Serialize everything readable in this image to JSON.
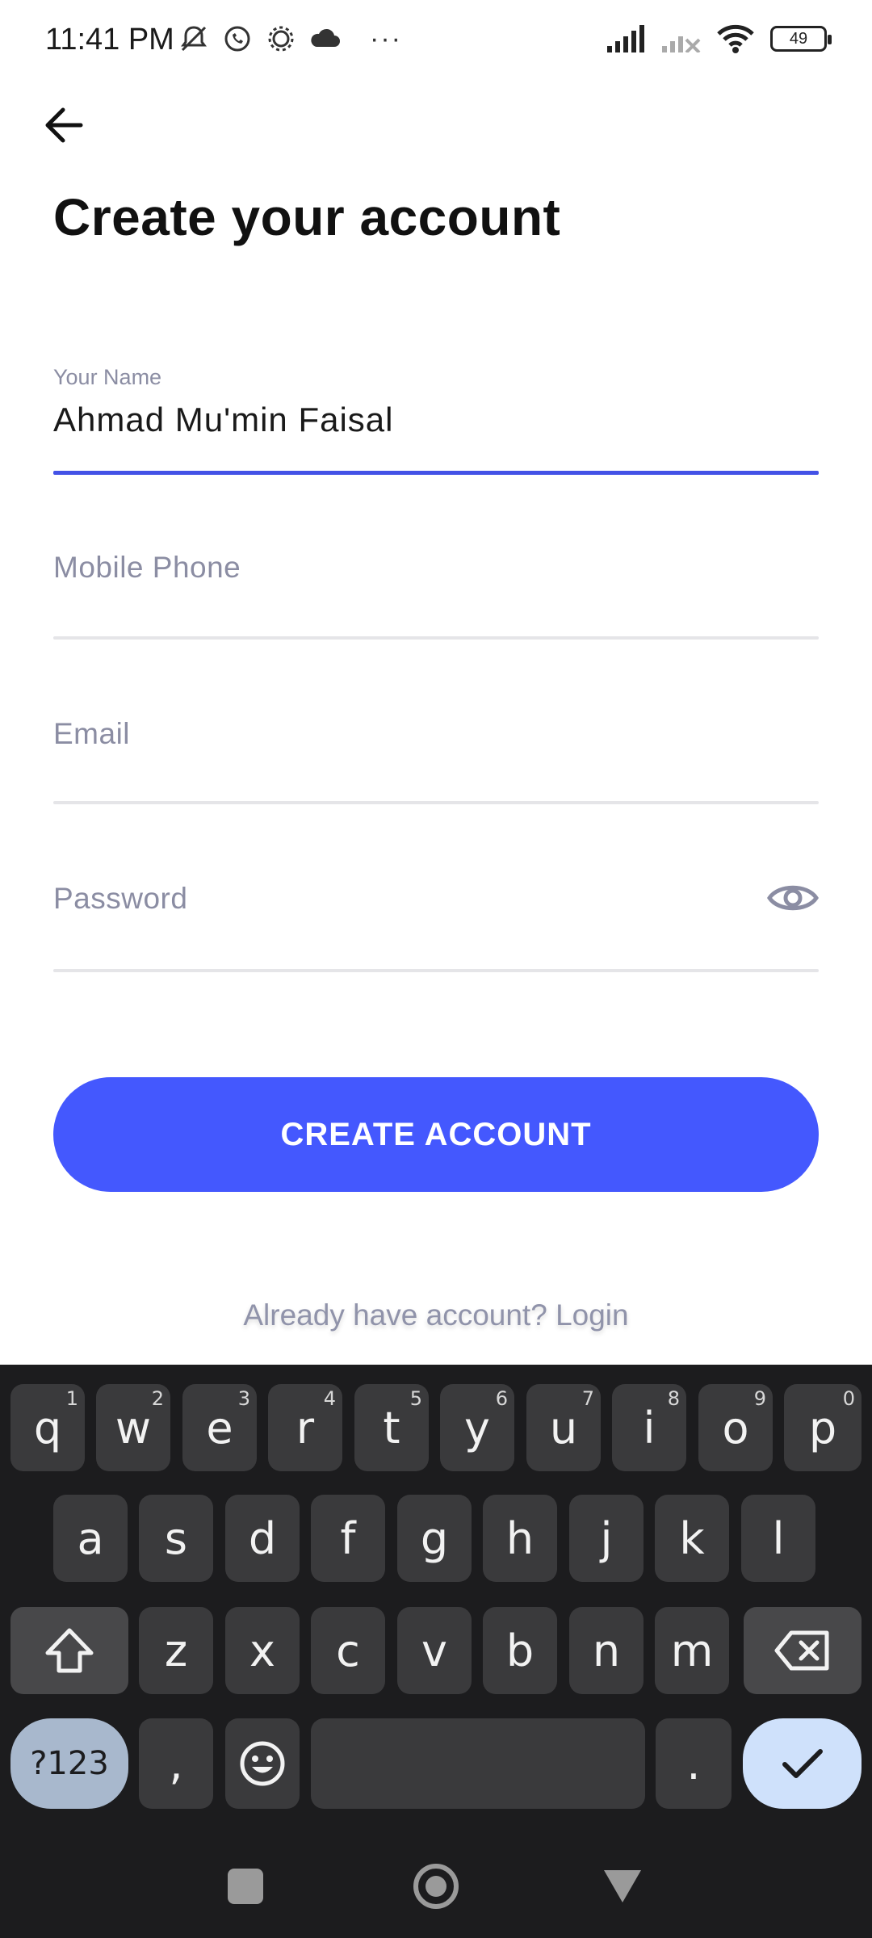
{
  "status_bar": {
    "time": "11:41 PM",
    "more": "···",
    "battery": "49",
    "icons_left": [
      "notifications-off-icon",
      "whatsapp-icon",
      "settings-gear-icon",
      "cloud-icon"
    ],
    "icons_right": [
      "signal-icon",
      "signal-secondary-off-icon",
      "wifi-icon",
      "battery-icon"
    ]
  },
  "header": {
    "back_icon": "arrow-left-icon",
    "title": "Create your account"
  },
  "form": {
    "name": {
      "label": "Your Name",
      "value": "Ahmad Mu'min Faisal"
    },
    "phone": {
      "placeholder": "Mobile Phone"
    },
    "email": {
      "placeholder": "Email"
    },
    "password": {
      "placeholder": "Password",
      "toggle_icon": "eye-icon"
    }
  },
  "actions": {
    "create_label": "CREATE ACCOUNT",
    "login_text": "Already have account? Login"
  },
  "keyboard": {
    "row1": [
      {
        "key": "q",
        "hint": "1"
      },
      {
        "key": "w",
        "hint": "2"
      },
      {
        "key": "e",
        "hint": "3"
      },
      {
        "key": "r",
        "hint": "4"
      },
      {
        "key": "t",
        "hint": "5"
      },
      {
        "key": "y",
        "hint": "6"
      },
      {
        "key": "u",
        "hint": "7"
      },
      {
        "key": "i",
        "hint": "8"
      },
      {
        "key": "o",
        "hint": "9"
      },
      {
        "key": "p",
        "hint": "0"
      }
    ],
    "row2": [
      "a",
      "s",
      "d",
      "f",
      "g",
      "h",
      "j",
      "k",
      "l"
    ],
    "row3": [
      "z",
      "x",
      "c",
      "v",
      "b",
      "n",
      "m"
    ],
    "symbols_label": "?123",
    "comma": ",",
    "period": ".",
    "colors": {
      "background": "#1c1c1e",
      "key": "#3a3a3c",
      "accent_enter": "#cfe1fb",
      "accent_symbols": "#a8b8cd"
    }
  },
  "colors": {
    "primary": "#4458fe",
    "active_underline": "#4352e6",
    "placeholder": "#8b8da3"
  }
}
